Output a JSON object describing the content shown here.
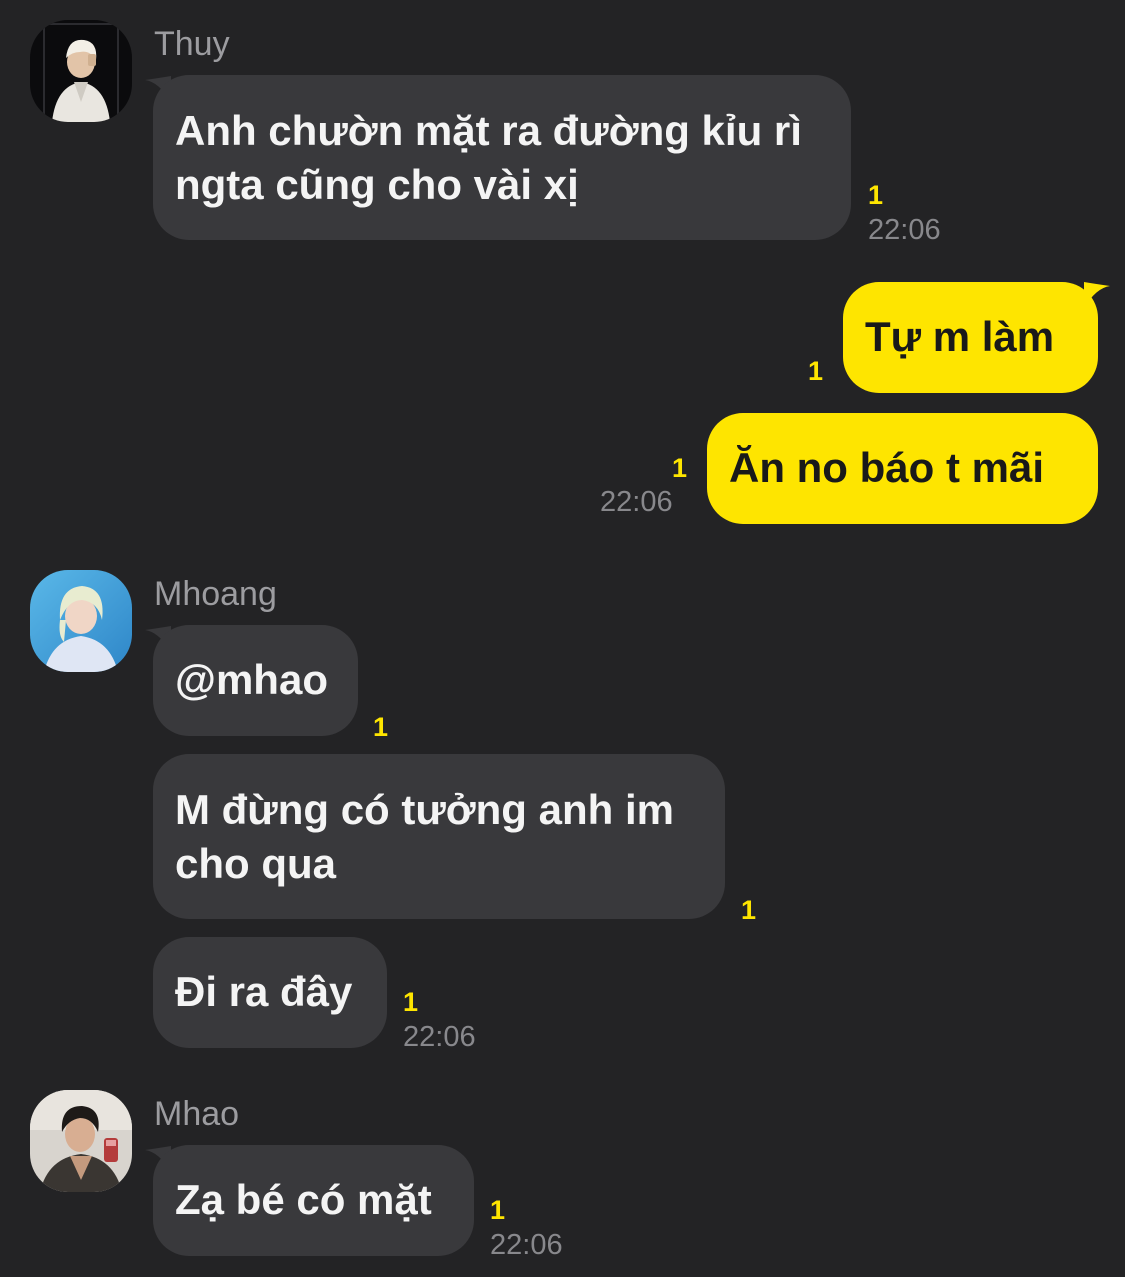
{
  "colors": {
    "background": "#232325",
    "incoming_bubble": "#39393c",
    "outgoing_bubble": "#fee500",
    "unread_count": "#fee500",
    "timestamp": "#88888c",
    "sender_name": "#9c9ca0"
  },
  "groups": [
    {
      "sender": "Thuy",
      "avatar_icon": "avatar-photo-icon",
      "messages": [
        {
          "lines": [
            "Anh chườn mặt ra đường kỉu rì",
            "ngta cũng cho vài xị"
          ],
          "unread": "1",
          "time": "22:06"
        }
      ]
    },
    {
      "sender": "me",
      "messages": [
        {
          "lines": [
            "Tự m làm"
          ],
          "unread": "1"
        },
        {
          "lines": [
            "Ăn no báo t mãi"
          ],
          "unread": "1",
          "time": "22:06"
        }
      ]
    },
    {
      "sender": "Mhoang",
      "avatar_icon": "avatar-photo-icon",
      "messages": [
        {
          "lines": [
            "@mhao"
          ],
          "unread": "1"
        },
        {
          "lines": [
            "M đừng có tưởng anh im",
            "cho qua"
          ],
          "unread": "1"
        },
        {
          "lines": [
            "Đi ra đây"
          ],
          "unread": "1",
          "time": "22:06"
        }
      ]
    },
    {
      "sender": "Mhao",
      "avatar_icon": "avatar-photo-icon",
      "messages": [
        {
          "lines": [
            "Zạ bé có mặt"
          ],
          "unread": "1",
          "time": "22:06"
        }
      ]
    }
  ]
}
